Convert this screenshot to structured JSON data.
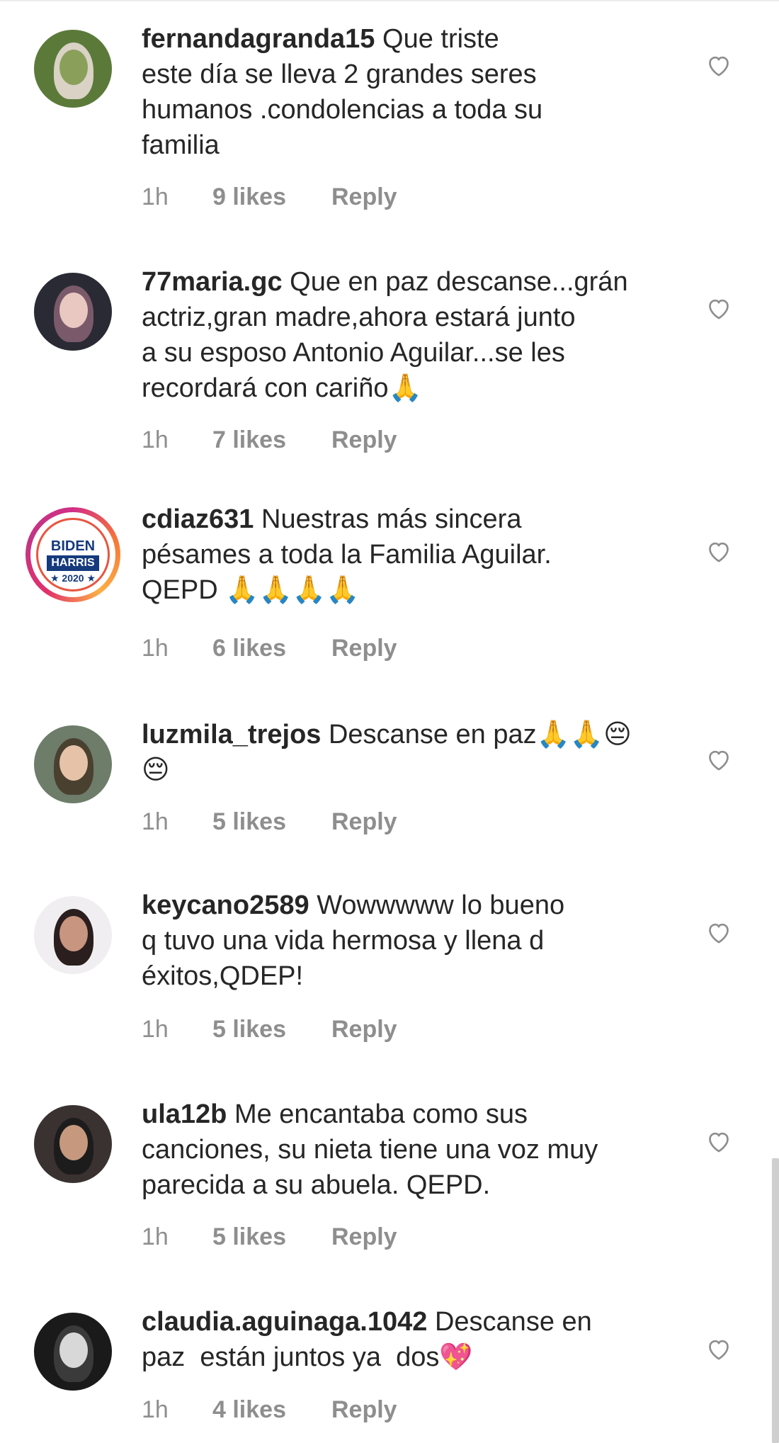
{
  "comments": [
    {
      "username": "fernandagranda15",
      "text": "Que triste\neste día se lleva 2 grandes seres\nhumanos .condolencias a toda su\nfamilia",
      "time": "1h",
      "likes": "9 likes",
      "reply": "Reply",
      "avatar_colors": [
        "#5b7a3a",
        "#8aa05a",
        "#d9d2c5"
      ]
    },
    {
      "username": "77maria.gc",
      "text": "Que en paz descanse...grán\nactriz,gran madre,ahora estará junto\na su esposo Antonio Aguilar...se les\nrecordará con cariño🙏",
      "time": "1h",
      "likes": "7 likes",
      "reply": "Reply",
      "avatar_colors": [
        "#2a2a34",
        "#e8c8c0",
        "#7a5a6a"
      ]
    },
    {
      "username": "cdiaz631",
      "text": "Nuestras más sincera\npésames a toda la Familia Aguilar.\nQEPD 🙏🙏🙏🙏",
      "time": "1h",
      "likes": "6 likes",
      "reply": "Reply",
      "badge": {
        "line1": "BIDEN",
        "line2": "HARRIS",
        "line3": "★ 2020 ★"
      }
    },
    {
      "username": "luzmila_trejos",
      "text": "Descanse en paz🙏🙏😔\n😔",
      "time": "1h",
      "likes": "5 likes",
      "reply": "Reply",
      "avatar_colors": [
        "#6e7c6a",
        "#e6c3a8",
        "#4a4030"
      ]
    },
    {
      "username": "keycano2589",
      "text": "Wowwwww lo bueno\nq tuvo una vida hermosa y llena d\néxitos,QDEP!",
      "time": "1h",
      "likes": "5 likes",
      "reply": "Reply",
      "avatar_colors": [
        "#f0eef0",
        "#c89580",
        "#2a1e1e"
      ]
    },
    {
      "username": "ula12b",
      "text": "Me encantaba como sus\ncanciones, su nieta tiene una voz muy\nparecida a su abuela. QEPD.",
      "time": "1h",
      "likes": "5 likes",
      "reply": "Reply",
      "avatar_colors": [
        "#3a3230",
        "#c6997e",
        "#1c1c1c"
      ]
    },
    {
      "username": "claudia.aguinaga.1042",
      "text": "Descanse en\npaz  están juntos ya  dos💖",
      "time": "1h",
      "likes": "4 likes",
      "reply": "Reply",
      "avatar_colors": [
        "#1a1a1a",
        "#d8d8d8",
        "#3a3a3a"
      ]
    }
  ],
  "colors": {
    "text": "#262626",
    "meta": "#8e8e8e",
    "heart": "#8e8e8e",
    "background": "#ffffff"
  },
  "icons": {
    "like": "heart-outline-icon"
  }
}
